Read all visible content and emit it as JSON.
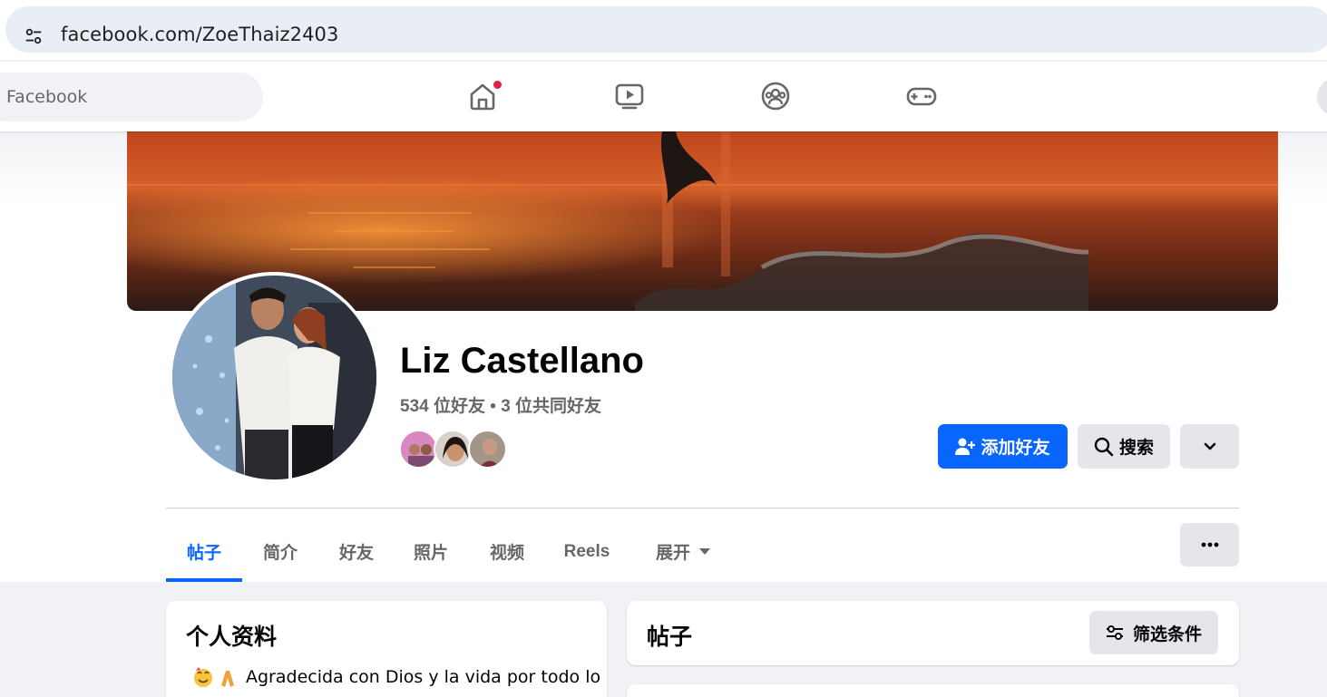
{
  "browser": {
    "url": "facebook.com/ZoeThaiz2403",
    "site_info_icon": "tune-icon"
  },
  "nav": {
    "search_placeholder": "Facebook",
    "icons": [
      "home-icon",
      "video-icon",
      "groups-icon",
      "gaming-icon"
    ],
    "home_notification": true
  },
  "profile": {
    "name": "Liz Castellano",
    "friend_stats": "534 位好友 • 3 位共同好友",
    "mutual_friends_count_shown": 3
  },
  "actions": {
    "add_friend": "添加好友",
    "search": "搜索",
    "more_icon": "chevron-down-icon"
  },
  "tabs": [
    {
      "label": "帖子",
      "active": true
    },
    {
      "label": "简介",
      "active": false
    },
    {
      "label": "好友",
      "active": false
    },
    {
      "label": "照片",
      "active": false
    },
    {
      "label": "视频",
      "active": false
    },
    {
      "label": "Reels",
      "active": false
    },
    {
      "label": "展开",
      "active": false
    }
  ],
  "intro": {
    "title": "个人资料",
    "text_line1": "Agradecida con Dios y la vida por todo lo"
  },
  "posts": {
    "title": "帖子",
    "filter_label": "筛选条件"
  },
  "colors": {
    "accent": "#0866ff",
    "notification": "#e41e3f",
    "secondary_text": "#65676b"
  }
}
